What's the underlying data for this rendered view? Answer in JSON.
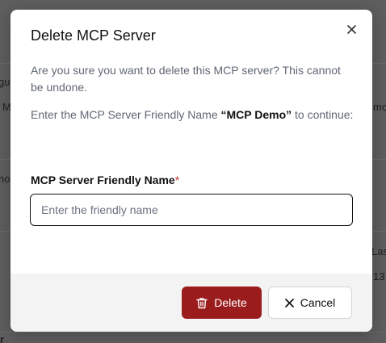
{
  "background": {
    "fragments": [
      "gu",
      "M",
      "mc",
      "no",
      "Las",
      "13 ",
      "r"
    ]
  },
  "modal": {
    "title": "Delete MCP Server",
    "close_icon": "close-icon",
    "confirm_text": "Are you sure you want to delete this MCP server? This cannot be undone.",
    "instruction_prefix": "Enter the MCP Server Friendly Name ",
    "server_name": "“MCP Demo”",
    "instruction_suffix": " to continue:",
    "field": {
      "label": "MCP Server Friendly Name",
      "required_marker": "*",
      "placeholder": "Enter the friendly name",
      "value": ""
    },
    "buttons": {
      "delete_label": "Delete",
      "delete_icon": "trash-icon",
      "cancel_label": "Cancel",
      "cancel_icon": "close-icon"
    }
  },
  "colors": {
    "overlay": "#5e5e5e",
    "danger": "#9b1c1c",
    "required": "#c0322b"
  }
}
